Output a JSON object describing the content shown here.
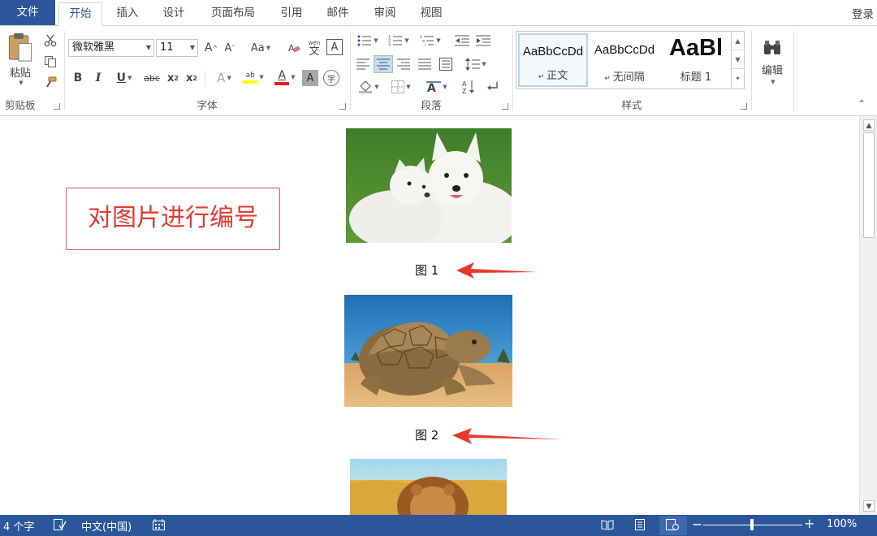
{
  "tabs": {
    "file": "文件",
    "items": [
      "开始",
      "插入",
      "设计",
      "页面布局",
      "引用",
      "邮件",
      "审阅",
      "视图"
    ],
    "login": "登录"
  },
  "ribbon": {
    "clipboard": {
      "paste": "粘贴",
      "label": "剪贴板"
    },
    "font": {
      "name": "微软雅黑",
      "size": "11",
      "grow": "A",
      "shrink": "A",
      "case": "Aa",
      "bold": "B",
      "italic": "I",
      "underline": "U",
      "strike": "abc",
      "sub": "x",
      "sup": "x",
      "text_effect": "A",
      "highlight": "ab",
      "font_color": "A",
      "char_shade": "A",
      "enclose": "字",
      "phonetic": "wén",
      "border_char": "A",
      "label": "字体"
    },
    "paragraph": {
      "label": "段落"
    },
    "styles": {
      "items": [
        {
          "sample": "AaBbCcDd",
          "name": "正文"
        },
        {
          "sample": "AaBbCcDd",
          "name": "无间隔"
        },
        {
          "sample": "AaBl",
          "name": "标题 1"
        }
      ],
      "label": "样式"
    },
    "editing": {
      "label": "编辑"
    }
  },
  "document": {
    "callout": "对图片进行编号",
    "captions": [
      "图 1",
      "图 2"
    ]
  },
  "status": {
    "words": "4 个字",
    "language": "中文(中国)",
    "zoom": "100%",
    "zoom_level": 1.0
  },
  "colors": {
    "brand": "#2b579a",
    "callout": "#e03c32",
    "arrow": "#e8382e"
  }
}
